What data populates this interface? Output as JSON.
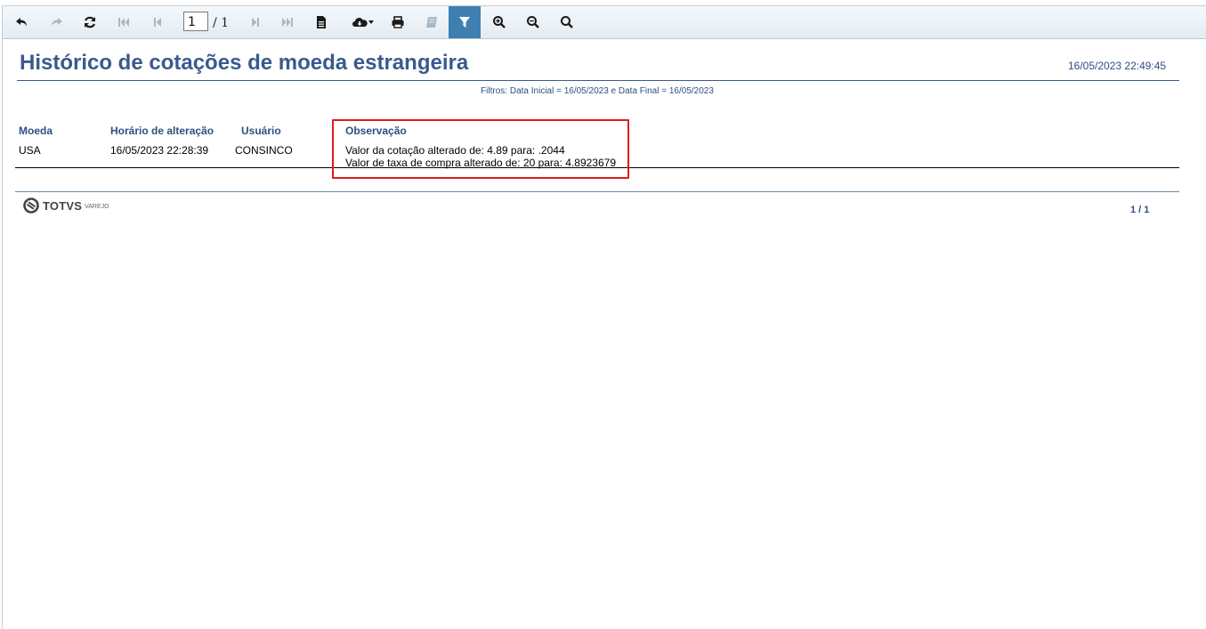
{
  "toolbar": {
    "buttons": [
      {
        "name": "undo-icon",
        "enabled": true
      },
      {
        "name": "redo-icon",
        "enabled": false
      },
      {
        "name": "refresh-icon",
        "enabled": true
      },
      {
        "name": "first-page-icon",
        "enabled": false
      },
      {
        "name": "previous-page-icon",
        "enabled": false
      },
      {
        "name": "next-page-icon",
        "enabled": false
      },
      {
        "name": "last-page-icon",
        "enabled": false
      },
      {
        "name": "document-icon",
        "enabled": true
      },
      {
        "name": "cloud-download-icon",
        "enabled": true
      },
      {
        "name": "print-icon",
        "enabled": true
      },
      {
        "name": "book-icon",
        "enabled": false
      },
      {
        "name": "filter-icon",
        "enabled": true,
        "active": true
      },
      {
        "name": "zoom-in-icon",
        "enabled": true
      },
      {
        "name": "zoom-out-icon",
        "enabled": true
      },
      {
        "name": "search-icon",
        "enabled": true
      }
    ],
    "current_page": "1",
    "total_pages": "/ 1",
    "active_color": "#3d7fb0",
    "icon_color": "#1a1a1a",
    "disabled_color": "#a9b8c6"
  },
  "report": {
    "title": "Histórico de cotações de moeda estrangeira",
    "generated_at": "16/05/2023 22:49:45",
    "filters": "Filtros: Data Inicial = 16/05/2023 e Data Final = 16/05/2023",
    "columns": [
      "Moeda",
      "Horário de alteração",
      "Usuário",
      "Observação"
    ],
    "rows": [
      {
        "moeda": "USA",
        "horario": "16/05/2023 22:28:39",
        "usuario": "CONSINCO",
        "observacao": [
          "Valor da cotação alterado de: 4.89 para: .2044",
          "Valor de taxa de compra alterado de: 20 para: 4.8923679"
        ]
      }
    ],
    "highlight_color": "#e01b1b",
    "heading_color": "#3a5a8c"
  },
  "footer": {
    "logo_text": "TOTVS",
    "logo_subtext": "VAREJO",
    "page_count": "1 / 1"
  }
}
